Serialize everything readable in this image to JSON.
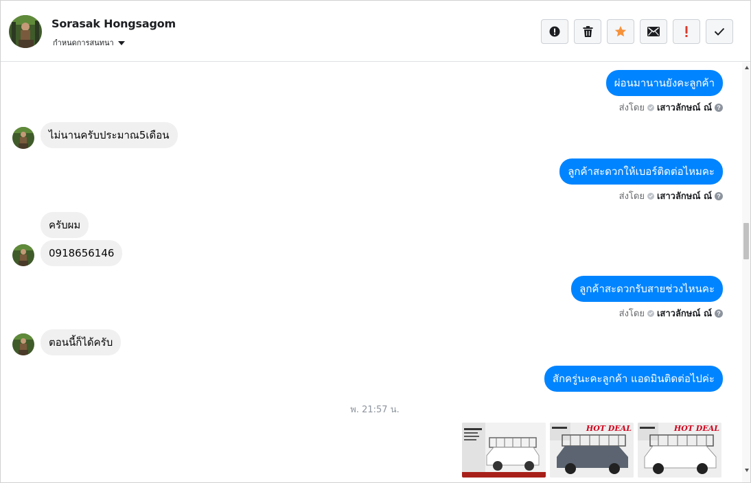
{
  "header": {
    "contact_name": "Sorasak Hongsagom",
    "assign_label": "กำหนดการสนทนา",
    "actions": [
      {
        "name": "report-spam-button",
        "icon": "alert-circle-icon"
      },
      {
        "name": "delete-button",
        "icon": "trash-icon"
      },
      {
        "name": "star-button",
        "icon": "star-icon"
      },
      {
        "name": "mark-unread-button",
        "icon": "envelope-icon"
      },
      {
        "name": "follow-up-button",
        "icon": "exclamation-icon"
      },
      {
        "name": "mark-done-button",
        "icon": "check-icon"
      }
    ]
  },
  "colors": {
    "outgoing_bubble": "#0084ff",
    "incoming_bubble": "#f0f0f0",
    "star": "#f7923b",
    "follow_up": "#d93a2b"
  },
  "messages": {
    "m1": "ผ่อนมานานยังคะลูกค้า",
    "m2": "ไม่นานครับประมาณ5เดือน",
    "m3": "ลูกค้าสะดวกให้เบอร์ติดต่อไหมคะ",
    "m4": "ครับผม",
    "m5": "0918656146",
    "m6": "ลูกค้าสะดวกรับสายช่วงไหนคะ",
    "m7": "ตอนนี้ก็ได้ครับ",
    "m8": "สักครู่นะคะลูกค้า แอดมินติดต่อไปค่ะ"
  },
  "sent_by": {
    "prefix": "ส่งโดย",
    "agent": "เสาวลักษณ์ ณ์",
    "help": "?"
  },
  "timestamp": "พ. 21:57 น.",
  "images": {
    "badge": "HOT DEAL"
  }
}
